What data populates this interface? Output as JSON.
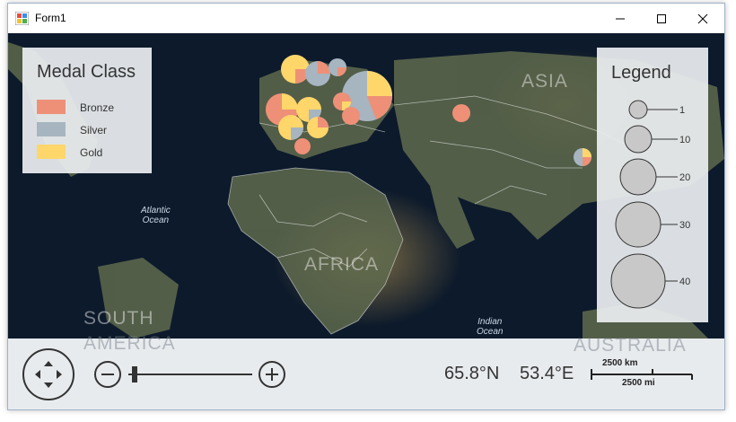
{
  "window": {
    "title": "Form1"
  },
  "colors": {
    "bronze": "#ee9077",
    "silver": "#a6b5c0",
    "gold": "#ffd66a",
    "legend_circle": "#c8c8c8"
  },
  "medal_legend": {
    "title": "Medal Class",
    "items": [
      {
        "label": "Bronze",
        "color": "#ee9077"
      },
      {
        "label": "Silver",
        "color": "#a6b5c0"
      },
      {
        "label": "Gold",
        "color": "#ffd66a"
      }
    ]
  },
  "size_legend": {
    "title": "Legend",
    "values": [
      "1",
      "10",
      "20",
      "30",
      "40"
    ]
  },
  "map_labels": {
    "atlantic": [
      "Atlantic",
      "Ocean"
    ],
    "indian": [
      "Indian",
      "Ocean"
    ],
    "asia": "ASIA",
    "africa": "AFRICA",
    "south_america": [
      "SOUTH",
      "AMERICA"
    ],
    "australia": "AUSTRALIA"
  },
  "status": {
    "latitude": "65.8°N",
    "longitude": "53.4°E",
    "scale_km": "2500 km",
    "scale_mi": "2500 mi"
  },
  "navigation": {
    "zoom_level": 0.03
  }
}
